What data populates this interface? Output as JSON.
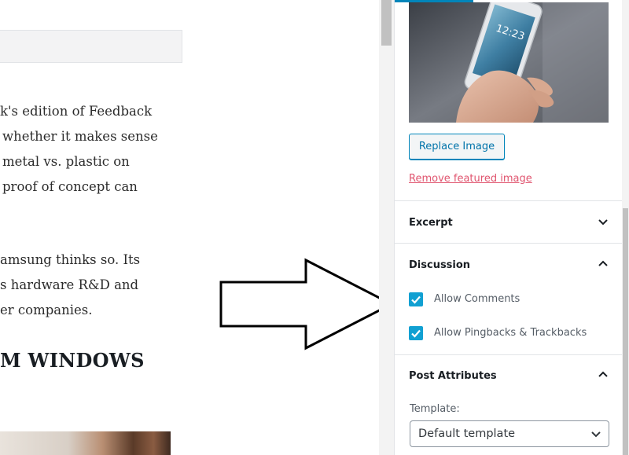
{
  "editor": {
    "paragraphs": [
      "k's edition of Feedback",
      "whether it makes sense",
      "metal vs. plastic on",
      "proof of concept can",
      "amsung thinks so. Its",
      "s hardware R&D and",
      "er companies."
    ],
    "heading": "M WINDOWS"
  },
  "sidebar": {
    "featured_image": {
      "replace_label": "Replace Image",
      "remove_label": "Remove featured image"
    },
    "excerpt": {
      "title": "Excerpt"
    },
    "discussion": {
      "title": "Discussion",
      "allow_comments": "Allow Comments",
      "allow_pingbacks": "Allow Pingbacks & Trackbacks"
    },
    "post_attributes": {
      "title": "Post Attributes",
      "template_label": "Template:",
      "template_value": "Default template"
    }
  },
  "colors": {
    "accent": "#0085ba",
    "checkbox": "#11a0d2",
    "remove_link": "#e0556f"
  }
}
